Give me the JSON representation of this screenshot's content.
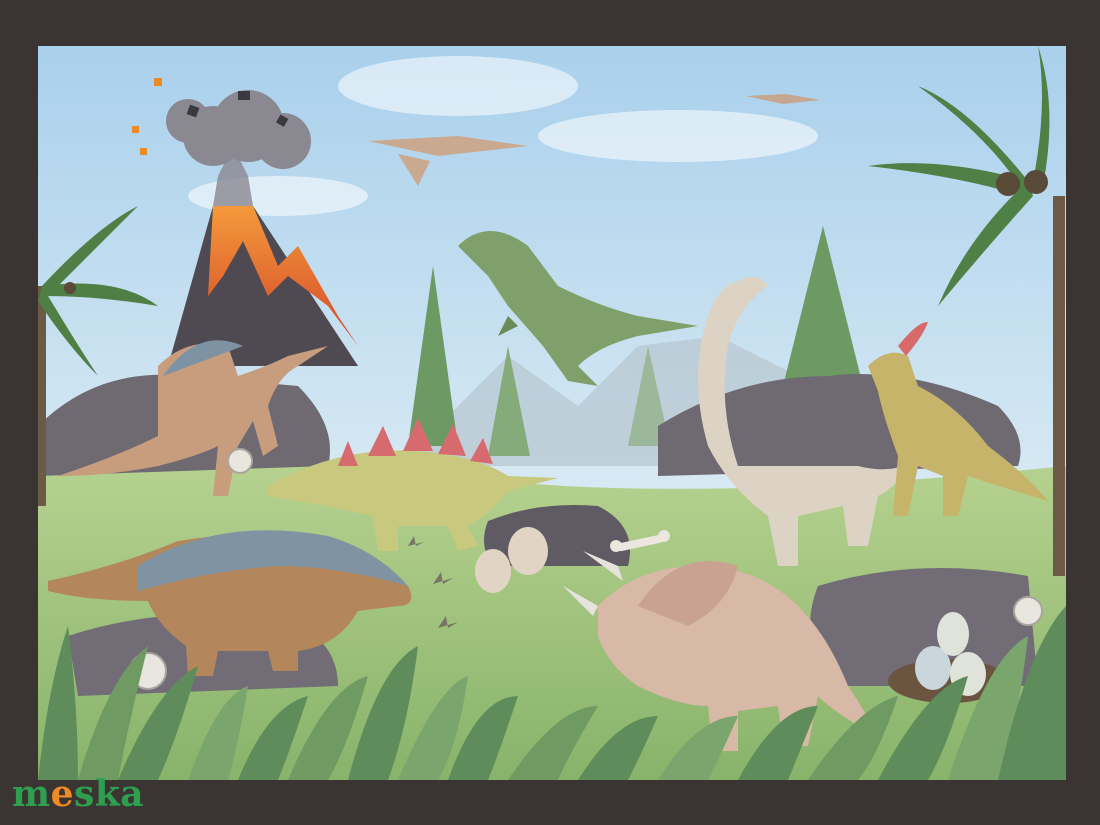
{
  "watermark": {
    "text": "meska",
    "accent_letter_index": 1,
    "color": "#2e9e4f",
    "accent_color": "#f08a24"
  },
  "frame": {
    "color": "#3a3533"
  },
  "artwork": {
    "style": "watercolor",
    "colors": {
      "sky_top": "#b8d8ee",
      "sky_bottom": "#e6f1f4",
      "grass": "#9ec27a",
      "foliage": "#5f8f55",
      "rock": "#6f6a72",
      "lava": "#f07a2a"
    },
    "icons": [
      "volcano-icon",
      "pteranodon-icon",
      "tyrannosaurus-icon",
      "spinosaurus-icon",
      "stegosaurus-icon",
      "brachiosaurus-icon",
      "parasaurolophus-icon",
      "ankylosaurus-icon",
      "triceratops-icon",
      "palm-tree-icon",
      "pine-tree-icon",
      "egg-nest-icon",
      "bone-icon",
      "ammonite-shell-icon",
      "fern-leaf-icon"
    ]
  }
}
